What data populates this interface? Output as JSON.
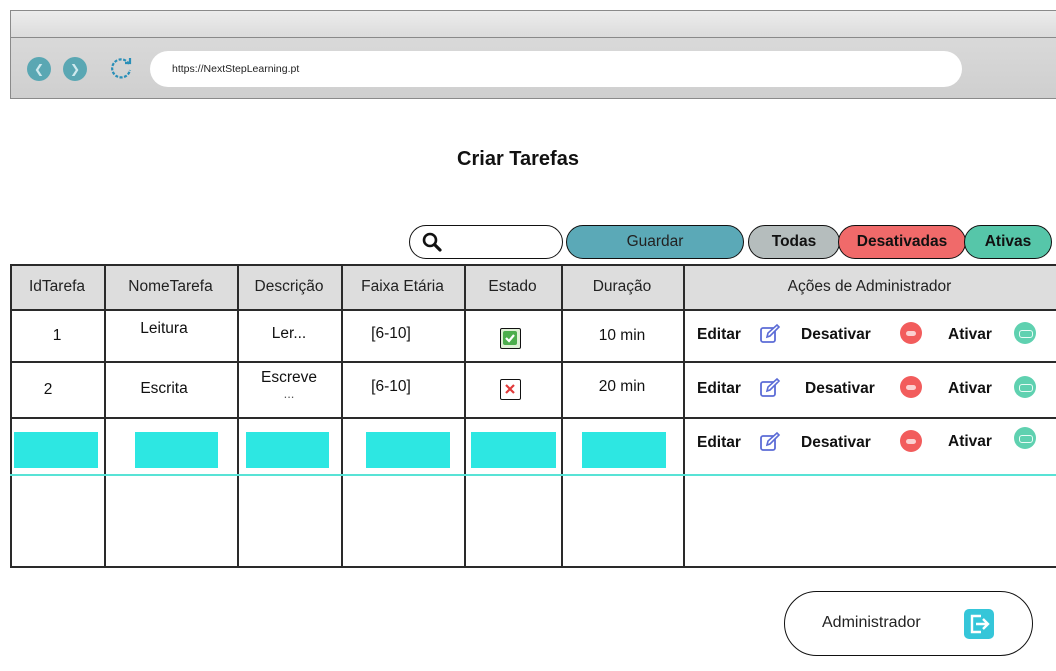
{
  "browser": {
    "url": "https://NextStepLearning.pt"
  },
  "page": {
    "title": "Criar Tarefas"
  },
  "search": {
    "placeholder": ""
  },
  "buttons": {
    "guardar": "Guardar",
    "todas": "Todas",
    "desativadas": "Desativadas",
    "ativas": "Ativas"
  },
  "table": {
    "headers": [
      "IdTarefa",
      "NomeTarefa",
      "Descrição",
      "Faixa Etária",
      "Estado",
      "Duração",
      "Ações de Administrador"
    ],
    "rows": [
      {
        "id": "1",
        "nome": "Leitura",
        "descricao": "Ler...",
        "faixa": "[6-10]",
        "estado": "checked",
        "duracao": "10 min"
      },
      {
        "id": "2",
        "nome": "Escrita",
        "descricao": "Escreve",
        "descricao2": "...",
        "faixa": "[6-10]",
        "estado": "unchecked",
        "duracao": "20 min"
      }
    ],
    "actions": {
      "edit": "Editar",
      "deactivate": "Desativar",
      "activate": "Ativar"
    }
  },
  "footer": {
    "admin_label": "Administrador"
  },
  "colors": {
    "guardar": "#5ba9b7",
    "todas": "#b5bdbd",
    "desativadas": "#f06a6a",
    "ativas": "#56c6a9",
    "new_row_placeholder": "#2de7e2"
  }
}
